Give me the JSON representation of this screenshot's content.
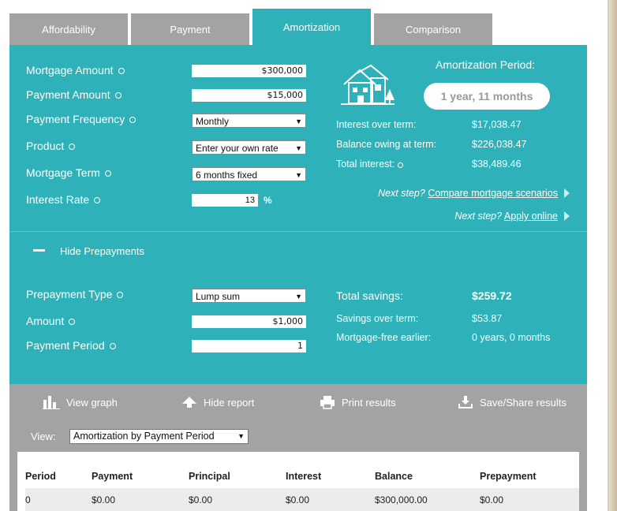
{
  "tabs": [
    "Affordability",
    "Payment",
    "Amortization",
    "Comparison"
  ],
  "form": {
    "mortgage_amount": {
      "label": "Mortgage Amount",
      "value": "$300,000"
    },
    "payment_amount": {
      "label": "Payment Amount",
      "value": "$15,000"
    },
    "payment_frequency": {
      "label": "Payment Frequency",
      "value": "Monthly"
    },
    "product": {
      "label": "Product",
      "value": "Enter your own rate"
    },
    "mortgage_term": {
      "label": "Mortgage Term",
      "value": "6 months fixed"
    },
    "interest_rate": {
      "label": "Interest Rate",
      "value": "13",
      "unit": "%"
    }
  },
  "summary": {
    "title": "Amortization Period:",
    "period": "1 year, 11 months",
    "stats": [
      {
        "label": "Interest over term:",
        "value": "$17,038.47"
      },
      {
        "label": "Balance owing at term:",
        "value": "$226,038.47"
      },
      {
        "label": "Total interest:",
        "value": "$38,489.46"
      }
    ],
    "next1": {
      "prefix": "Next step?",
      "link": "Compare mortgage scenarios"
    },
    "next2": {
      "prefix": "Next step?",
      "link": "Apply online"
    }
  },
  "prepay": {
    "toggle_label": "Hide Prepayments",
    "type": {
      "label": "Prepayment Type",
      "value": "Lump sum"
    },
    "amount": {
      "label": "Amount",
      "value": "$1,000"
    },
    "period": {
      "label": "Payment Period",
      "value": "1"
    },
    "total_savings": {
      "label": "Total savings:",
      "value": "$259.72"
    },
    "savings_over_term": {
      "label": "Savings over term:",
      "value": "$53.87"
    },
    "mortgage_free": {
      "label": "Mortgage-free earlier:",
      "value": "0 years, 0 months"
    }
  },
  "toolbar": {
    "view_graph": "View graph",
    "hide_report": "Hide report",
    "print": "Print results",
    "save": "Save/Share results"
  },
  "view": {
    "label": "View:",
    "value": "Amortization by Payment Period"
  },
  "table": {
    "headers": [
      "Period",
      "Payment",
      "Principal",
      "Interest",
      "Balance",
      "Prepayment"
    ],
    "rows": [
      [
        "0",
        "$0.00",
        "$0.00",
        "$0.00",
        "$300,000.00",
        "$0.00"
      ]
    ]
  }
}
